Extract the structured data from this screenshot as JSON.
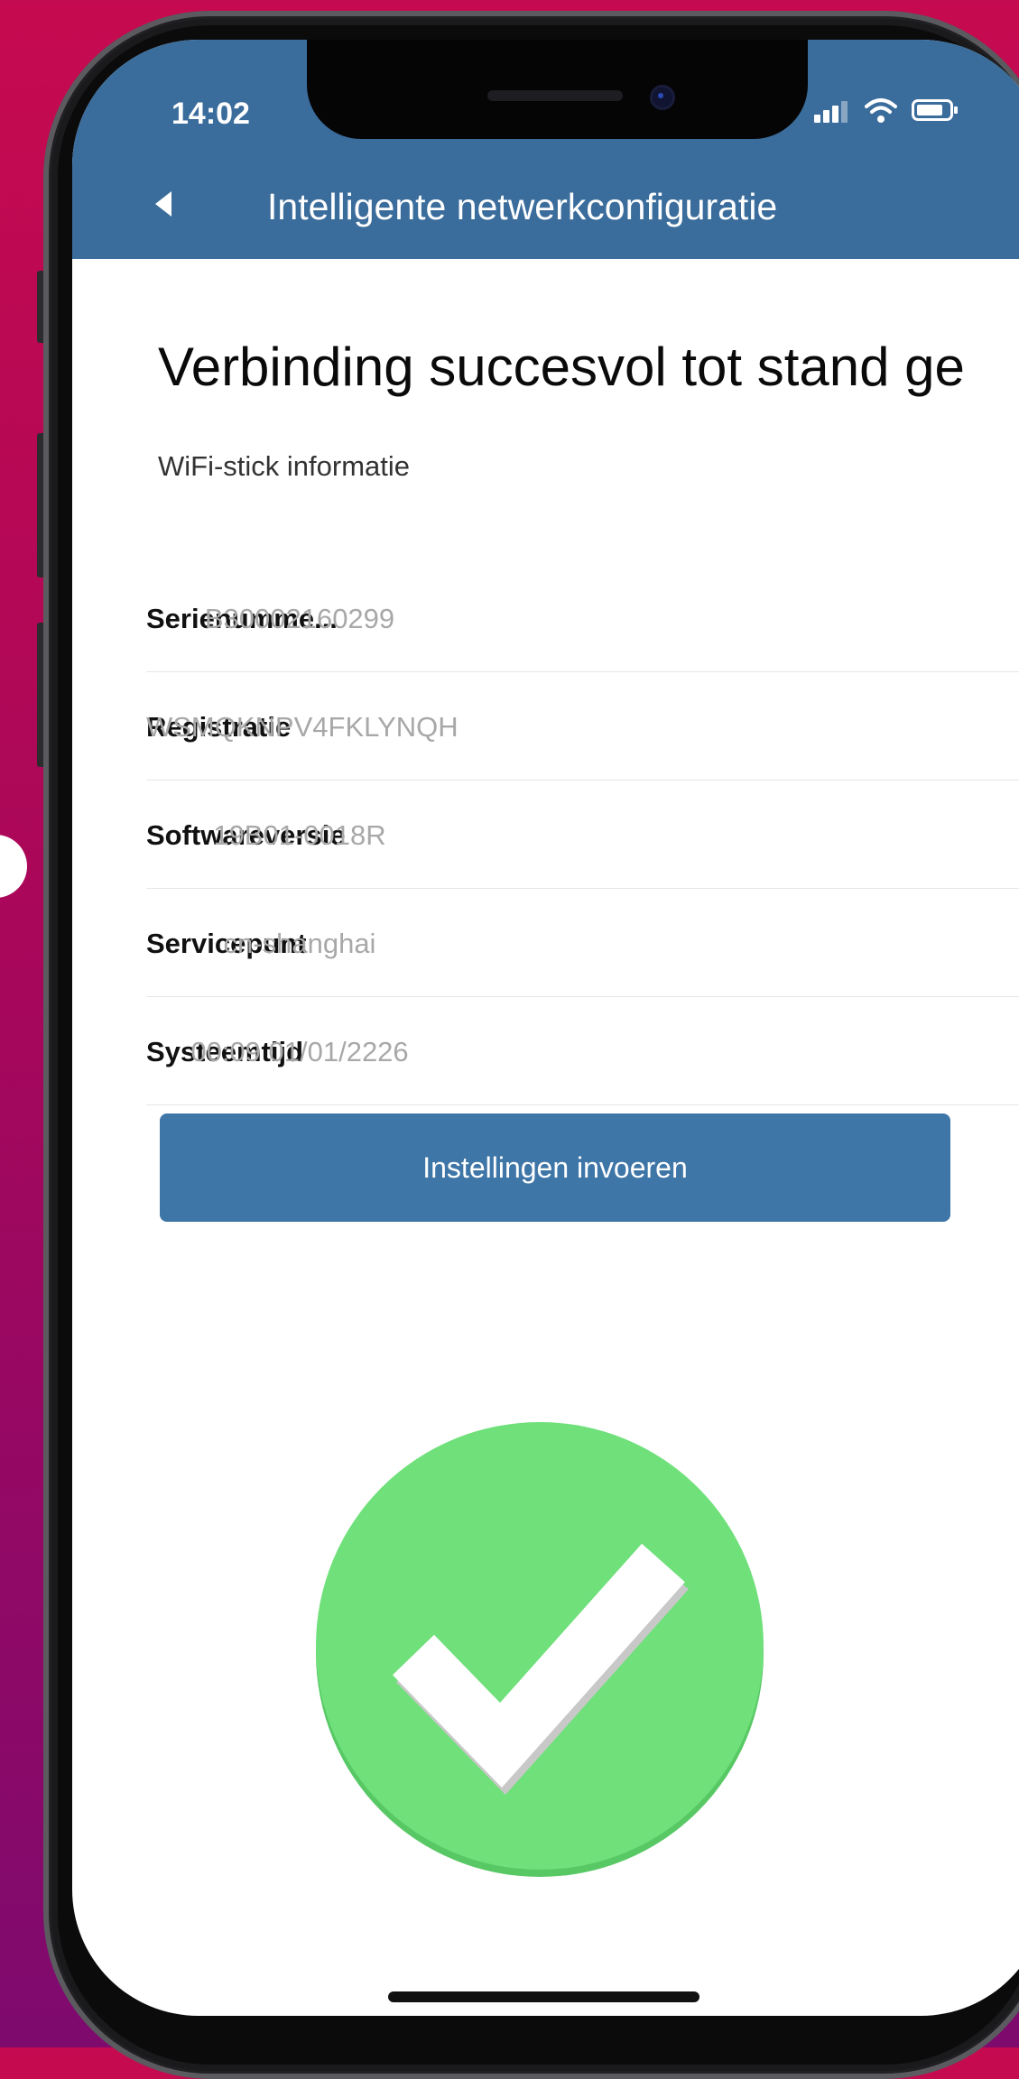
{
  "status_bar": {
    "time": "14:02"
  },
  "header": {
    "title": "Intelligente netwerkconfiguratie"
  },
  "main": {
    "heading": "Verbinding succesvol tot stand ge",
    "section_label": "WiFi-stick informatie",
    "info_rows": [
      {
        "label": "Serienumme...",
        "value": "B30002160299"
      },
      {
        "label": "Registratie",
        "value": "WSMQKNPV4FKLYNQH"
      },
      {
        "label": "Softwareversie",
        "value": "19B01-0018R"
      },
      {
        "label": "Servicepunt",
        "value": "cn-shanghai"
      },
      {
        "label": "Systeemtijd",
        "value": "00:09 01/01/2226"
      }
    ],
    "button_label": "Instellingen invoeren"
  },
  "colors": {
    "header": "#3b6d9c",
    "button": "#3f76a8",
    "success": "#6fe07a",
    "background_top": "#c60a4f",
    "background_bottom": "#7e0a6e"
  },
  "icons": [
    "back-arrow-icon",
    "signal-icon",
    "wifi-icon",
    "battery-icon",
    "success-check-icon"
  ]
}
